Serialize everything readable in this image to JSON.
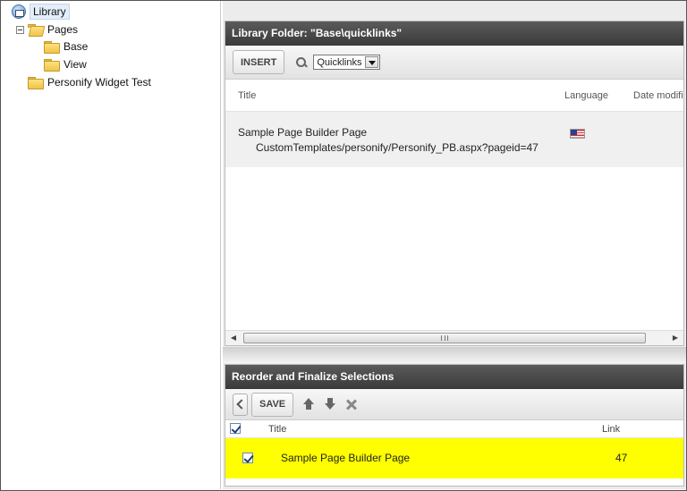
{
  "tree": {
    "root_label": "Library",
    "items": [
      {
        "label": "Pages"
      },
      {
        "label": "Base"
      },
      {
        "label": "View"
      },
      {
        "label": "Personify Widget Test"
      }
    ]
  },
  "library_panel": {
    "title": "Library Folder: \"Base\\quicklinks\"",
    "insert_label": "INSERT",
    "filter_value": "Quicklinks",
    "columns": {
      "title": "Title",
      "language": "Language",
      "date": "Date modifi"
    },
    "rows": [
      {
        "title": "Sample Page Builder Page",
        "path": "CustomTemplates/personify/Personify_PB.aspx?pageid=47",
        "language_icon": "us-flag-icon"
      }
    ],
    "scroll_grip": "III"
  },
  "selections_panel": {
    "title": "Reorder and Finalize Selections",
    "save_label": "SAVE",
    "columns": {
      "title": "Title",
      "link": "Link"
    },
    "rows": [
      {
        "title": "Sample Page Builder Page",
        "link": "47",
        "checked": true,
        "highlight": "#ffff00"
      }
    ]
  }
}
